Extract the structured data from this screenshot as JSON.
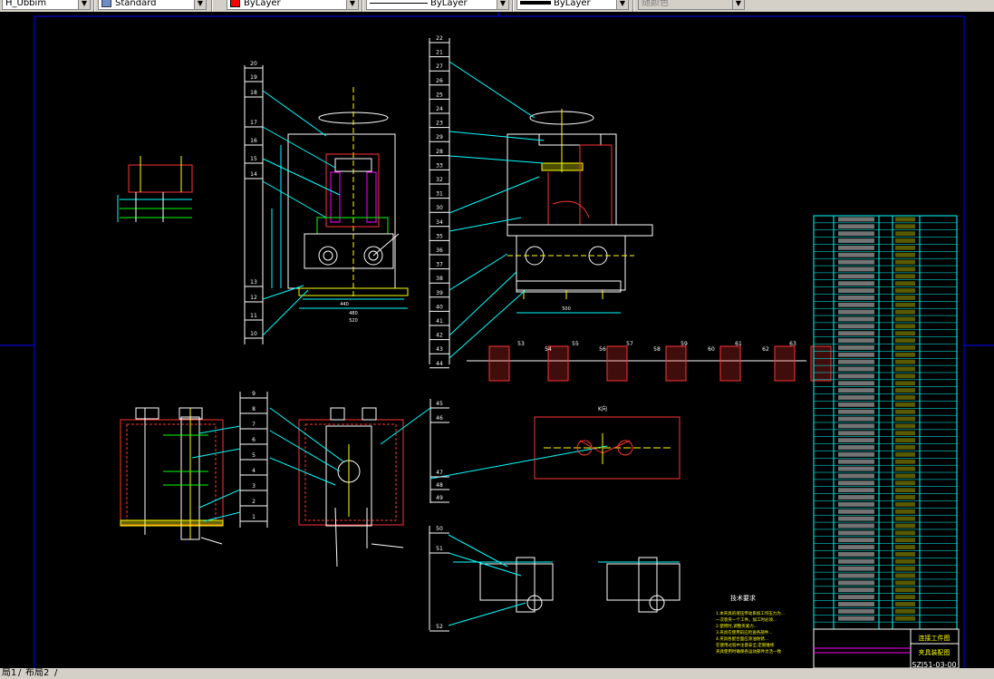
{
  "toolbar": {
    "plot_style": "H_Ubbim",
    "text_style": "Standard",
    "layer_color": "ByLayer",
    "linetype": "ByLayer",
    "lineweight": "ByLayer",
    "plot_color": "随颜色",
    "accent_colors": {
      "layer": "#ff0000",
      "line": "#000000"
    }
  },
  "drawing": {
    "leader_numbers_front": [
      "20",
      "19",
      "18",
      "17",
      "16",
      "15",
      "14",
      "13",
      "12",
      "11",
      "10"
    ],
    "leader_numbers_side": [
      "22",
      "21",
      "27",
      "26",
      "25",
      "24",
      "23",
      "29",
      "28",
      "33",
      "32",
      "31",
      "30",
      "34",
      "35",
      "36",
      "37",
      "38",
      "39",
      "40",
      "41",
      "42",
      "43",
      "44"
    ],
    "section_numbers": [
      "53",
      "54",
      "55",
      "56",
      "57",
      "58",
      "59",
      "60",
      "61",
      "62",
      "63"
    ],
    "leader_numbers_bottom_left": [
      "9",
      "8",
      "7",
      "6",
      "5",
      "4",
      "3",
      "2",
      "1"
    ],
    "leader_numbers_bottom_mid": [
      "45",
      "46",
      "47",
      "48",
      "49"
    ],
    "leader_numbers_bottom": [
      "50",
      "51",
      "52"
    ],
    "dim_front_width": "480",
    "dim_front_width2": "520",
    "dim_front_width3": "440",
    "dim_side_width": "500",
    "detail_label": "K向",
    "tech_req_title": "技术要求",
    "tech_req_lines": [
      "1.本夹具的液压传动系统工作压力为...",
      "一次装夹一个工件。加工时必须...",
      "2.使用时,调整夹紧力...",
      "3.夹具在使用前应检查各部件...",
      "4.夹具各配合面应涂油防锈...",
      "在使用过程中注意安全,定期维修",
      "夹具使用时确保各运动部件灵活一致"
    ],
    "title_block_line1": "连接工件图",
    "title_block_line2": "夹具装配图",
    "drawing_number": "SZJ51-03-00"
  },
  "bom": {
    "rows": 58,
    "columns": 5
  },
  "layout_tabs": [
    "局1",
    "布局2"
  ]
}
